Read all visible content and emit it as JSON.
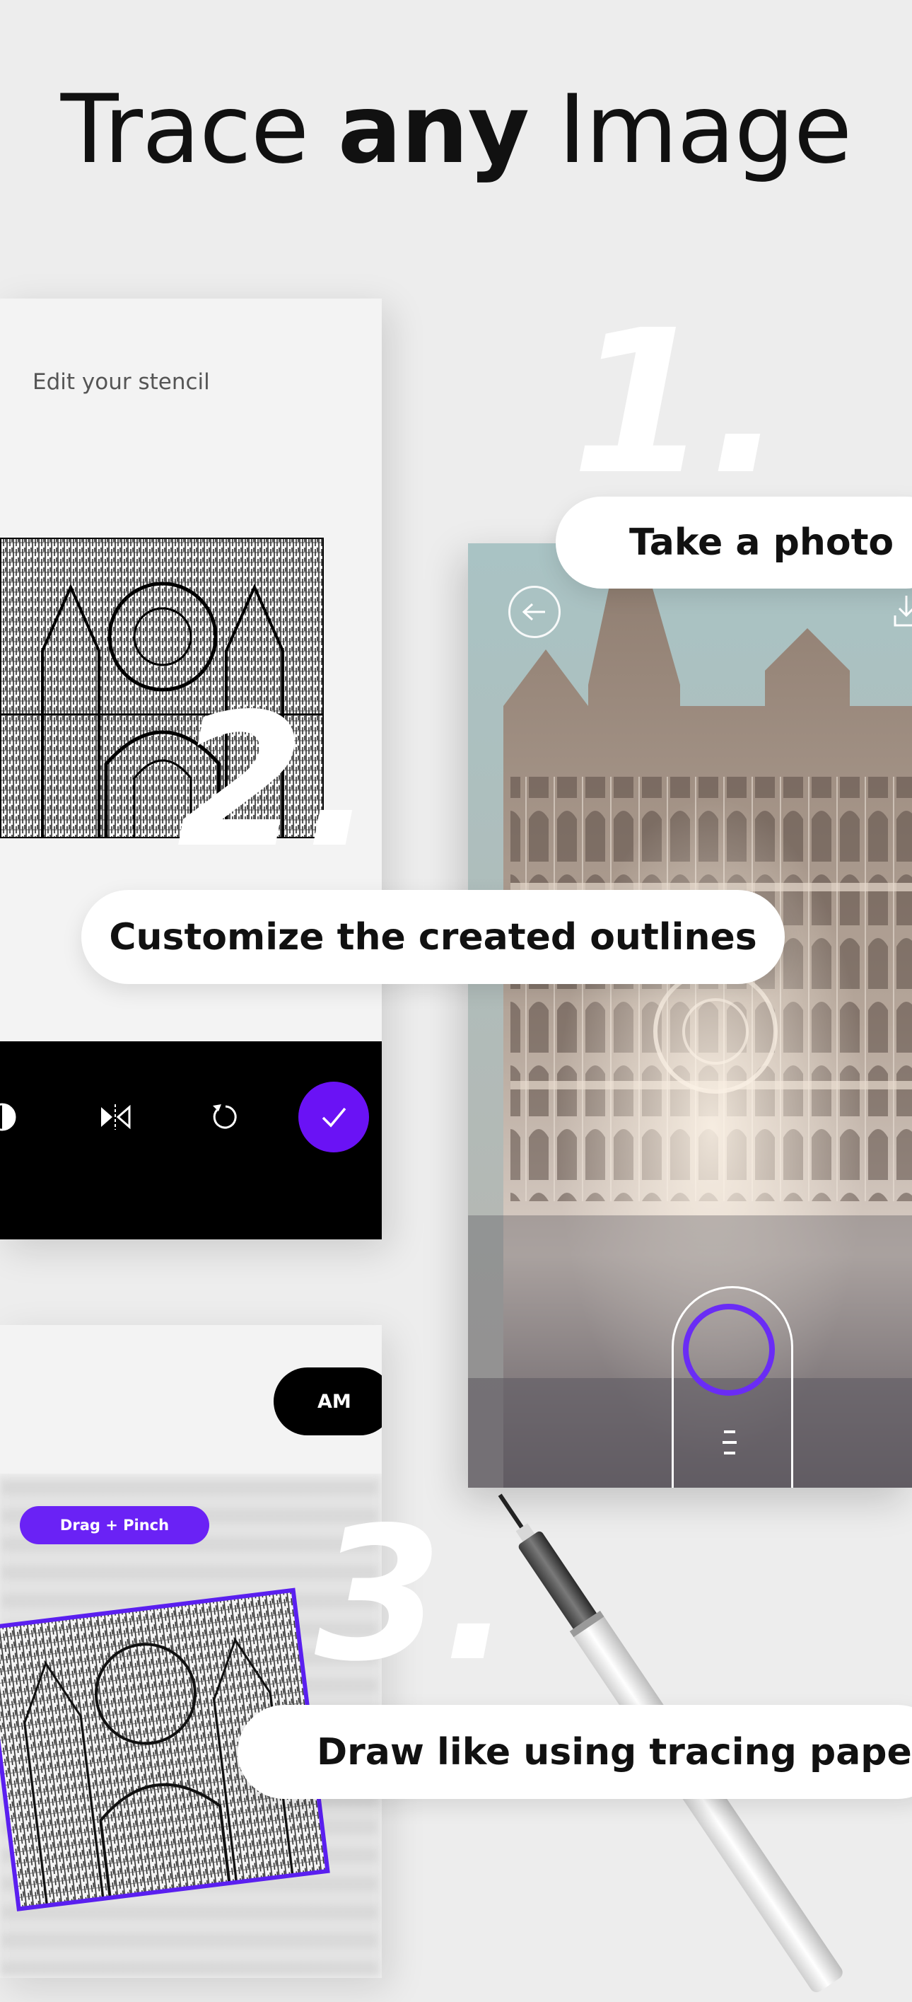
{
  "headline": {
    "prefix": "Trace ",
    "emphasis": "any",
    "suffix": " Image"
  },
  "steps": [
    {
      "numeral": "1.",
      "label": "Take a photo"
    },
    {
      "numeral": "2.",
      "label": "Customize the created outlines"
    },
    {
      "numeral": "3.",
      "label": "Draw like using tracing paper"
    }
  ],
  "stencil_screen": {
    "title": "Edit your stencil",
    "tools": [
      "contrast-icon",
      "flip-icon",
      "rotate-icon",
      "checkmark-icon"
    ]
  },
  "camera_screen": {
    "icons": [
      "back-arrow-icon",
      "share-icon",
      "shutter-button",
      "menu-icon"
    ]
  },
  "trace_screen": {
    "mode_toggle": "AM",
    "hint": "Drag + Pinch"
  },
  "colors": {
    "accent": "#6a12f5",
    "background": "#ededed",
    "text": "#111111"
  }
}
